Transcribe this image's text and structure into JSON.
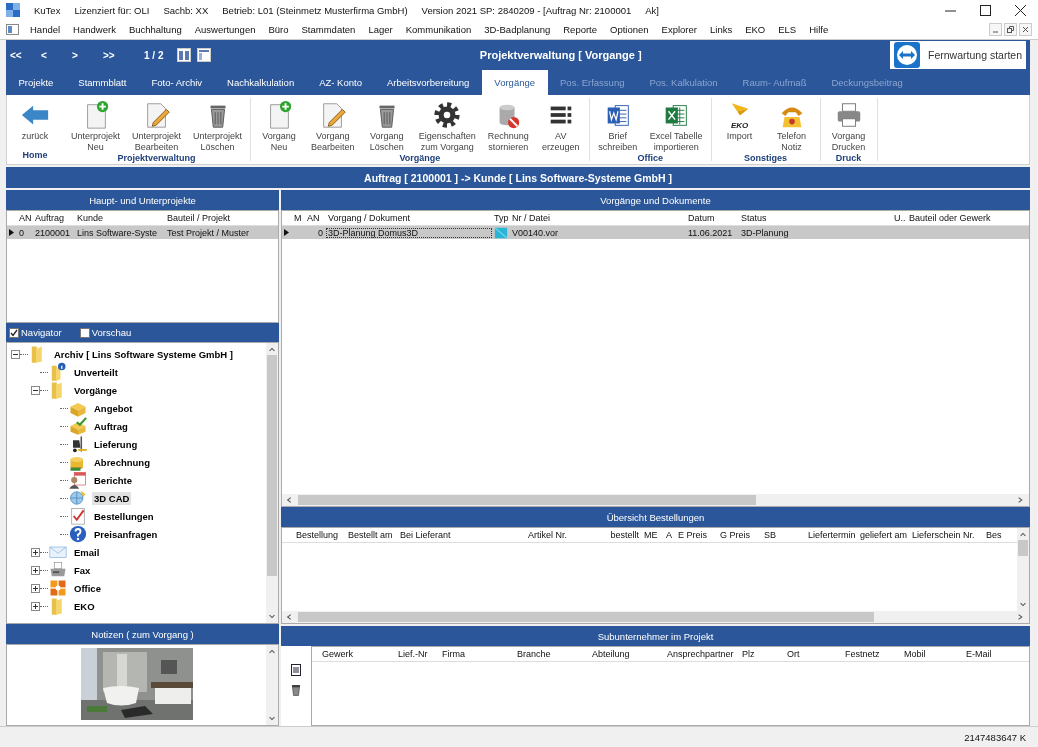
{
  "window": {
    "title_parts": [
      "KuTex",
      "Lizenziert für: OLI",
      "Sachb: XX",
      "Betrieb: L01 (Steinmetz Musterfirma GmbH)",
      "Version 2021 SP: 2840209 - [Auftrag Nr: 2100001",
      "Ak]"
    ]
  },
  "menu": [
    "Handel",
    "Handwerk",
    "Buchhaltung",
    "Auswertungen",
    "Büro",
    "Stammdaten",
    "Lager",
    "Kommunikation",
    "3D-Badplanung",
    "Reporte",
    "Optionen",
    "Explorer",
    "Links",
    "EKO",
    "ELS",
    "Hilfe"
  ],
  "navigator": {
    "buttons": [
      "<<",
      "<",
      ">",
      ">>"
    ],
    "page": "1 / 2",
    "title": "Projektverwaltung  [ Vorgange ]",
    "remote_button": "Fernwartung starten"
  },
  "tabs": [
    {
      "label": "Projekte",
      "selected": false,
      "disabled": false
    },
    {
      "label": "Stammblatt",
      "selected": false,
      "disabled": false
    },
    {
      "label": "Foto- Archiv",
      "selected": false,
      "disabled": false
    },
    {
      "label": "Nachkalkulation",
      "selected": false,
      "disabled": false
    },
    {
      "label": "AZ- Konto",
      "selected": false,
      "disabled": false
    },
    {
      "label": "Arbeitsvorbereitung",
      "selected": false,
      "disabled": false
    },
    {
      "label": "Vorgänge",
      "selected": true,
      "disabled": false
    },
    {
      "label": "Pos. Erfassung",
      "selected": false,
      "disabled": true
    },
    {
      "label": "Pos. Kalkulation",
      "selected": false,
      "disabled": true
    },
    {
      "label": "Raum- Aufmaß",
      "selected": false,
      "disabled": true
    },
    {
      "label": "Deckungsbeitrag",
      "selected": false,
      "disabled": true
    }
  ],
  "ribbon": [
    {
      "group": "Home",
      "buttons": [
        {
          "label": "zurück",
          "kind": "back"
        }
      ]
    },
    {
      "group": "Projektverwaltung",
      "buttons": [
        {
          "label": "Unterprojekt\nNeu",
          "kind": "docadd"
        },
        {
          "label": "Unterprojekt\nBearbeiten",
          "kind": "docedit"
        },
        {
          "label": "Unterprojekt\nLöschen",
          "kind": "trash"
        }
      ]
    },
    {
      "group": "Vorgänge",
      "buttons": [
        {
          "label": "Vorgang\nNeu",
          "kind": "docadd"
        },
        {
          "label": "Vorgang\nBearbeiten",
          "kind": "docedit"
        },
        {
          "label": "Vorgang\nLöschen",
          "kind": "trash"
        },
        {
          "label": "Eigenschaften\nzum Vorgang",
          "kind": "gear"
        },
        {
          "label": "Rechnung\nstornieren",
          "kind": "dbcancel"
        },
        {
          "label": "AV\nerzeugen",
          "kind": "list"
        }
      ]
    },
    {
      "group": "Office",
      "buttons": [
        {
          "label": "Brief\nschreiben",
          "kind": "word"
        },
        {
          "label": "Excel Tabelle\nimportieren",
          "kind": "excel"
        }
      ]
    },
    {
      "group": "Sonstiges",
      "buttons": [
        {
          "label": "Import",
          "kind": "eko",
          "icon_text": "EKO"
        },
        {
          "label": "Telefon\nNotiz",
          "kind": "phone"
        }
      ]
    },
    {
      "group": "Druck",
      "buttons": [
        {
          "label": "Vorgang\nDrucken",
          "kind": "printer"
        }
      ]
    }
  ],
  "header": "Auftrag [ 2100001 ] -> Kunde [ Lins Software-Systeme GmbH ]",
  "projects": {
    "title": "Haupt- und Unterprojekte",
    "columns": [
      "AN",
      "Auftrag",
      "Kunde",
      "Bauteil / Projekt"
    ],
    "rows": [
      {
        "selected": true,
        "cells": [
          "0",
          "2100001",
          "Lins Software-Syste",
          "Test Projekt / Muster"
        ]
      }
    ]
  },
  "view_toggles": [
    {
      "label": "Navigator",
      "checked": true
    },
    {
      "label": "Vorschau",
      "checked": false
    }
  ],
  "tree": [
    {
      "label": "Archiv [ Lins Software Systeme GmbH ]",
      "kind": "folder",
      "expanded": true,
      "selected": false,
      "children": [
        {
          "label": "Unverteilt",
          "kind": "folderinfo",
          "selected": false
        },
        {
          "label": "Vorgänge",
          "kind": "folder",
          "expanded": true,
          "selected": false,
          "children": [
            {
              "label": "Angebot",
              "kind": "box",
              "selected": false
            },
            {
              "label": "Auftrag",
              "kind": "boxcheck",
              "selected": false
            },
            {
              "label": "Lieferung",
              "kind": "forklift",
              "selected": false
            },
            {
              "label": "Abrechnung",
              "kind": "coins",
              "selected": false
            },
            {
              "label": "Berichte",
              "kind": "report",
              "selected": false
            },
            {
              "label": "3D CAD",
              "kind": "cad",
              "selected": true
            },
            {
              "label": "Bestellungen",
              "kind": "checklist",
              "selected": false
            },
            {
              "label": "Preisanfragen",
              "kind": "help",
              "selected": false
            }
          ]
        },
        {
          "label": "Email",
          "kind": "mail",
          "expanded": false,
          "selected": false
        },
        {
          "label": "Fax",
          "kind": "fax",
          "expanded": false,
          "selected": false
        },
        {
          "label": "Office",
          "kind": "office",
          "expanded": false,
          "selected": false
        },
        {
          "label": "EKO",
          "kind": "folder",
          "expanded": false,
          "selected": false
        }
      ]
    }
  ],
  "notes": {
    "title": "Notizen ( zum Vorgang )"
  },
  "documents": {
    "title": "Vorgänge und Dokumente",
    "columns": [
      "M",
      "AN",
      "Vorgang / Dokument",
      "Typ",
      "Nr / Datei",
      "Datum",
      "Status",
      "U..",
      "Bauteil oder Gewerk"
    ],
    "rows": [
      {
        "selected": true,
        "an": "0",
        "document": "3D-Planung Domus3D",
        "number": "V00140.vor",
        "date": "11.06.2021",
        "status": "3D-Planung"
      }
    ]
  },
  "orders": {
    "title": "Übersicht Bestellungen",
    "columns": [
      "Bestellung",
      "Bestellt am",
      "Bei Lieferant",
      "Artikel Nr.",
      "bestellt",
      "ME",
      "A",
      "E Preis",
      "G Preis",
      "SB",
      "Liefertermin",
      "geliefert am",
      "Lieferschein Nr.",
      "Bes"
    ]
  },
  "subcontractors": {
    "title": "Subunternehmer im Projekt",
    "columns": [
      "Gewerk",
      "Lief.-Nr",
      "Firma",
      "Branche",
      "Abteilung",
      "Ansprechpartner",
      "Plz",
      "Ort",
      "Festnetz",
      "Mobil",
      "E-Mail"
    ]
  },
  "status_bar": {
    "text": "2147483647 K"
  }
}
